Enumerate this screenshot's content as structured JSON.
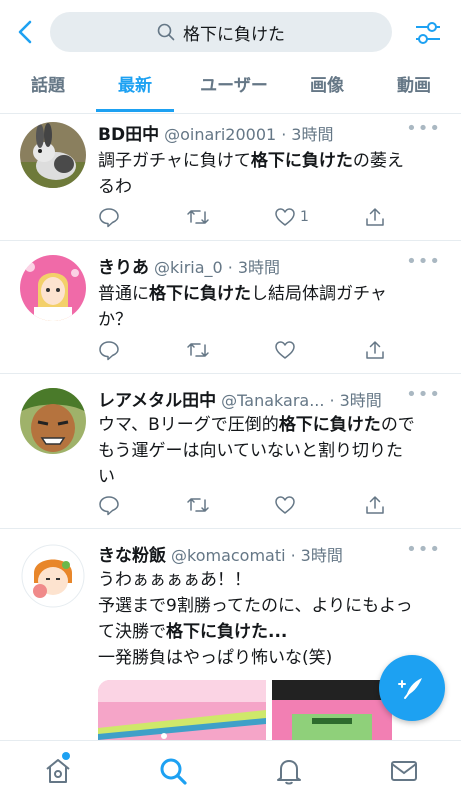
{
  "search": {
    "query": "格下に負けた"
  },
  "tabs": [
    {
      "label": "話題",
      "active": false
    },
    {
      "label": "最新",
      "active": true
    },
    {
      "label": "ユーザー",
      "active": false
    },
    {
      "label": "画像",
      "active": false
    },
    {
      "label": "動画",
      "active": false
    }
  ],
  "tweets": [
    {
      "name": "BD田中",
      "handle": "@oinari20001",
      "time": "3時間",
      "body": [
        "調子ガチャに負けて",
        "格下に負けた",
        "の萎え",
        "るわ"
      ],
      "likes": "1"
    },
    {
      "name": "きりあ",
      "handle": "@kiria_0",
      "time": "3時間",
      "body": [
        "普通に",
        "格下に負けた",
        "し結局体調ガチャ",
        "か？"
      ],
      "likes": ""
    },
    {
      "name": "レアメタル田中",
      "handle": "@Tanakara...",
      "time": "3時間",
      "body": [
        "ウマ、Bリーグで圧倒的",
        "格下に負けた",
        "ので",
        "もう運ゲーは向いていないと割り切りた",
        "い"
      ],
      "likes": ""
    },
    {
      "name": "きな粉飯",
      "handle": "@komacomati",
      "time": "3時間",
      "body": [
        "うわぁぁぁぁあ！！",
        "予選まで9割勝ってたのに、よりにもよっ",
        "て決勝で",
        "格下に負けた...",
        "一発勝負はやっぱり怖いな(笑)"
      ],
      "likes": ""
    }
  ],
  "common": {
    "dot": "·",
    "more": "•••"
  },
  "colors": {
    "accent": "#1da1f2",
    "muted": "#657786",
    "divider": "#e6ecf0"
  },
  "icons": [
    "back-chevron-icon",
    "search-icon",
    "filter-sliders-icon",
    "reply-icon",
    "retweet-icon",
    "like-heart-icon",
    "share-icon",
    "compose-feather-icon",
    "home-icon",
    "explore-search-icon",
    "notifications-bell-icon",
    "messages-envelope-icon"
  ]
}
